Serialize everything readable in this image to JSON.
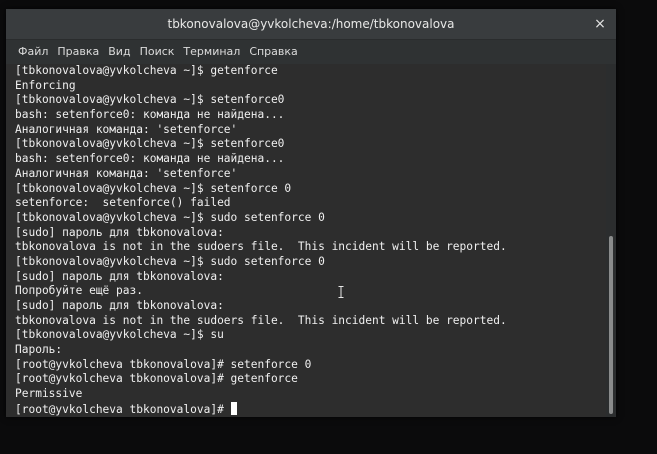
{
  "window": {
    "title": "tbkonovalova@yvkolcheva:/home/tbkonovalova",
    "close_glyph": "×"
  },
  "menu": [
    {
      "label": "Файл"
    },
    {
      "label": "Правка"
    },
    {
      "label": "Вид"
    },
    {
      "label": "Поиск"
    },
    {
      "label": "Терминал"
    },
    {
      "label": "Справка"
    }
  ],
  "terminal": {
    "lines": [
      "[tbkonovalova@yvkolcheva ~]$ getenforce",
      "Enforcing",
      "[tbkonovalova@yvkolcheva ~]$ setenforce0",
      "bash: setenforce0: команда не найдена...",
      "Аналогичная команда: 'setenforce'",
      "[tbkonovalova@yvkolcheva ~]$ setenforce0",
      "bash: setenforce0: команда не найдена...",
      "Аналогичная команда: 'setenforce'",
      "[tbkonovalova@yvkolcheva ~]$ setenforce 0",
      "setenforce:  setenforce() failed",
      "[tbkonovalova@yvkolcheva ~]$ sudo setenforce 0",
      "[sudo] пароль для tbkonovalova:",
      "tbkonovalova is not in the sudoers file.  This incident will be reported.",
      "[tbkonovalova@yvkolcheva ~]$ sudo setenforce 0",
      "[sudo] пароль для tbkonovalova:",
      "Попробуйте ещё раз.",
      "[sudo] пароль для tbkonovalova:",
      "tbkonovalova is not in the sudoers file.  This incident will be reported.",
      "[tbkonovalova@yvkolcheva ~]$ su",
      "Пароль:",
      "[root@yvkolcheva tbkonovalova]# setenforce 0",
      "[root@yvkolcheva tbkonovalova]# getenforce",
      "Permissive"
    ],
    "prompt": "[root@yvkolcheva tbkonovalova]# "
  },
  "colors": {
    "titlebar": "#393c3e",
    "terminal_bg": "#2d2d2d",
    "text": "#f0f0f0"
  }
}
